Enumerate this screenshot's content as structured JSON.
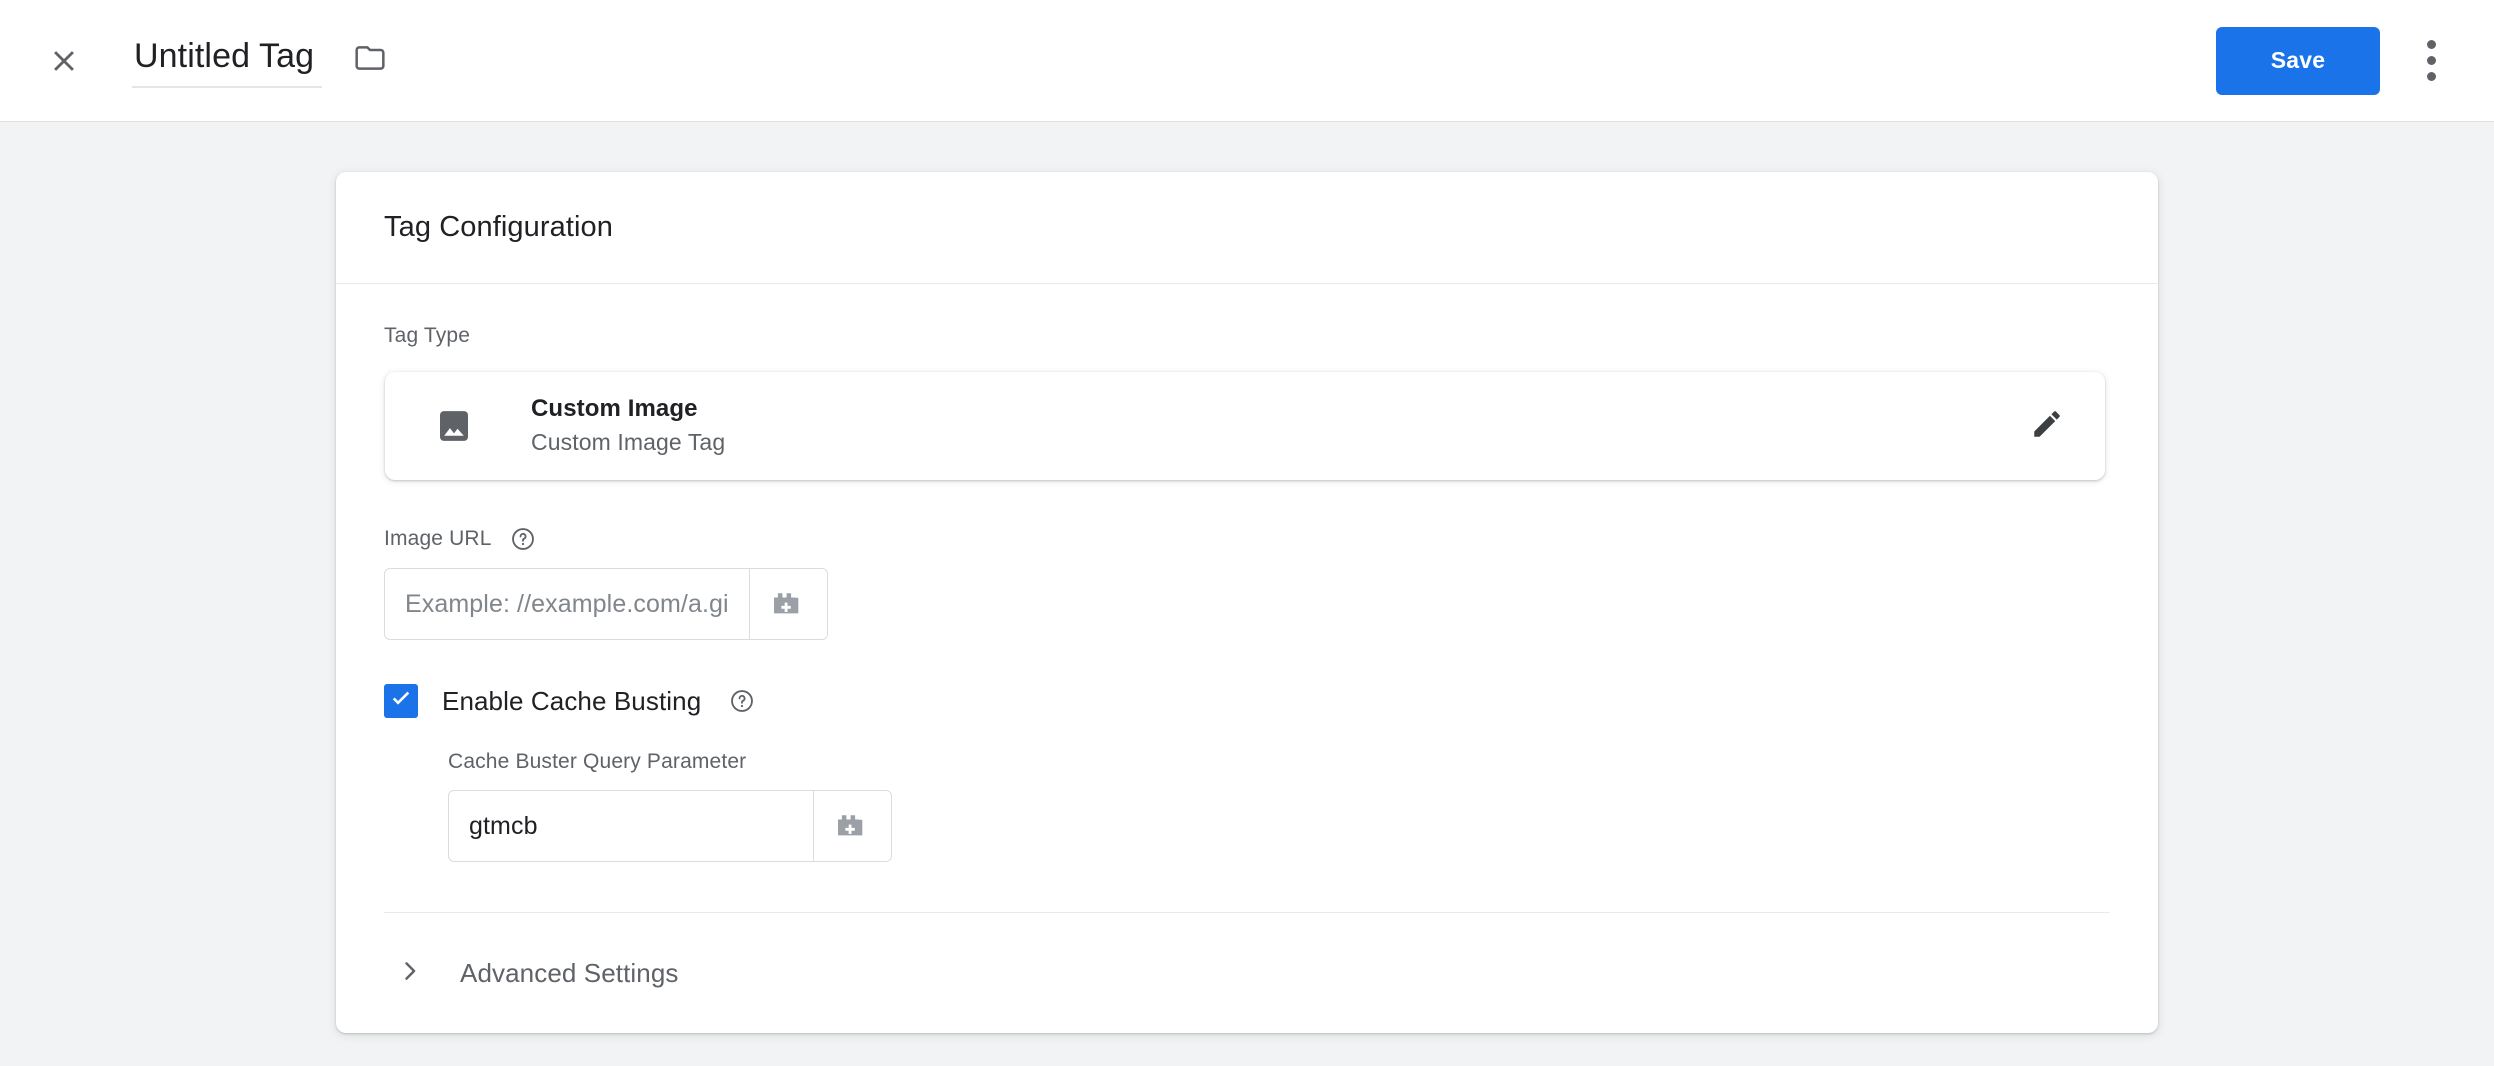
{
  "appbar": {
    "close_icon": "close-icon",
    "title": "Untitled Tag",
    "title_placeholder": "Untitled Tag",
    "folder_icon": "folder-icon",
    "save_label": "Save",
    "more_icon": "more-vert-icon",
    "accent_color": "#1a73e8"
  },
  "card": {
    "header_title": "Tag Configuration",
    "tag_type": {
      "label": "Tag Type",
      "icon": "image-icon",
      "name": "Custom Image",
      "description": "Custom Image Tag",
      "edit_icon": "pencil-icon"
    },
    "image_url": {
      "label": "Image URL",
      "help_icon": "help-circle-icon",
      "value": "",
      "placeholder": "Example: //example.com/a.gif",
      "variable_icon": "variable-picker-icon"
    },
    "cache_busting": {
      "checked": true,
      "label": "Enable Cache Busting",
      "help_icon": "help-circle-icon",
      "param_label": "Cache Buster Query Parameter",
      "param_value": "gtmcb",
      "param_placeholder": "",
      "variable_icon": "variable-picker-icon"
    },
    "advanced": {
      "chevron_icon": "chevron-right-icon",
      "label": "Advanced Settings"
    }
  },
  "colors": {
    "page_background": "#f1f3f4",
    "surface": "#ffffff",
    "primary_text": "#202124",
    "secondary_text": "#5f6368",
    "accent": "#1a73e8",
    "border": "#dadce0"
  }
}
